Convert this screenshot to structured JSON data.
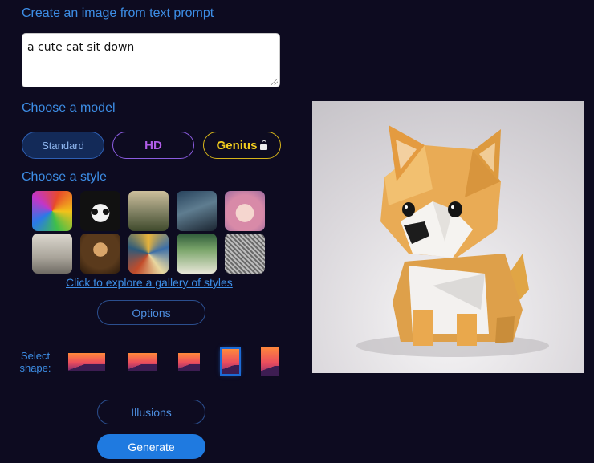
{
  "headings": {
    "create": "Create an image from text prompt",
    "model": "Choose a model",
    "style": "Choose a style"
  },
  "prompt": {
    "value": "a cute cat sit down"
  },
  "models": {
    "standard": "Standard",
    "hd": "HD",
    "genius": "Genius"
  },
  "gallery_link": "Click to explore a gallery of styles",
  "buttons": {
    "options": "Options",
    "illusions": "Illusions",
    "generate": "Generate"
  },
  "shape": {
    "label_line1": "Select",
    "label_line2": "shape:"
  },
  "icons": [
    "lock-icon",
    "resize-grip-icon"
  ],
  "colors": {
    "background": "#0d0b20",
    "accent": "#3d8ee6",
    "hd": "#b05ce8",
    "genius": "#f0cc1e",
    "generate": "#1f7ae0"
  }
}
